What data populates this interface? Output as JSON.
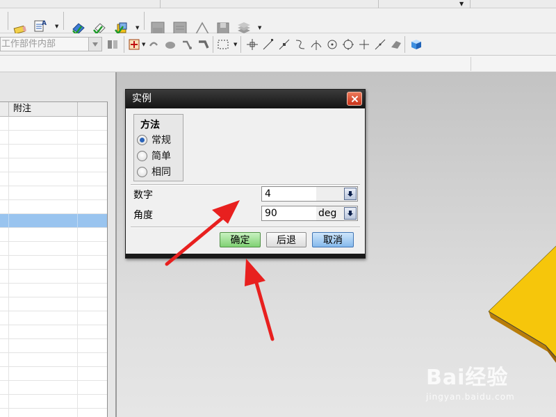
{
  "toolbar": {
    "work_part_combo": "工作部件内部"
  },
  "table": {
    "columns": [
      "",
      "附注",
      ""
    ]
  },
  "dialog": {
    "title": "实例",
    "method": {
      "title": "方法",
      "options": [
        "常规",
        "简单",
        "相同"
      ],
      "selected_index": 0
    },
    "number_label": "数字",
    "number_value": "4",
    "angle_label": "角度",
    "angle_value": "90",
    "angle_unit": "deg",
    "ok_label": "确定",
    "back_label": "后退",
    "cancel_label": "取消"
  },
  "watermark": {
    "brand": "Bai经验",
    "url": "jingyan.baidu.com"
  },
  "colors": {
    "selected_row": "#99c4ef",
    "ok_button": "#7fd173",
    "cancel_button": "#85b9ec",
    "plate": "#f6c60b",
    "annotation_arrow": "#e8201f"
  }
}
